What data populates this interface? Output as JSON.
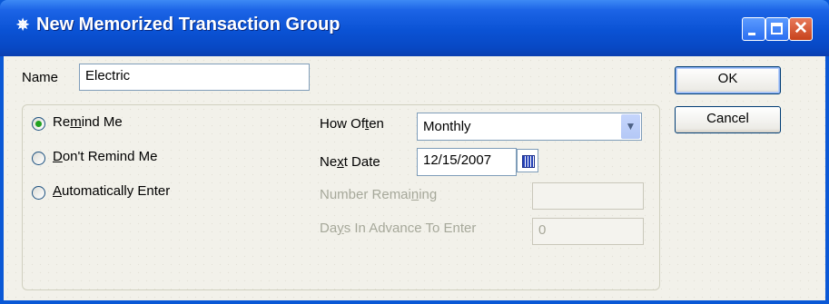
{
  "window": {
    "title": "New Memorized Transaction Group",
    "app_icon": "quickbooks-memorize-icon",
    "controls": [
      "minimize",
      "maximize",
      "close"
    ]
  },
  "name_field": {
    "label_pre": "N",
    "label_ul": "",
    "label_post": "ame",
    "value": "Electric"
  },
  "options": [
    {
      "label_pre": "Re",
      "label_ul": "m",
      "label_post": "ind Me",
      "checked": true
    },
    {
      "label_pre": "",
      "label_ul": "D",
      "label_post": "on't Remind Me",
      "checked": false
    },
    {
      "label_pre": "",
      "label_ul": "A",
      "label_post": "utomatically Enter",
      "checked": false
    }
  ],
  "how_often": {
    "label_pre": "How Of",
    "label_ul": "t",
    "label_post": "en",
    "value": "Monthly"
  },
  "next_date": {
    "label_pre": "Ne",
    "label_ul": "x",
    "label_post": "t Date",
    "value": "12/15/2007"
  },
  "number_remaining": {
    "label_pre": "Number Remai",
    "label_ul": "n",
    "label_post": "ing",
    "value": ""
  },
  "days_in_advance": {
    "label_pre": "Da",
    "label_ul": "y",
    "label_post": "s In Advance To Enter",
    "value": "0"
  },
  "buttons": {
    "ok": "OK",
    "cancel": "Cancel"
  },
  "colors": {
    "titlebar": "#0a52d4",
    "client": "#f2f1ea",
    "radio_dot": "#21a121"
  }
}
